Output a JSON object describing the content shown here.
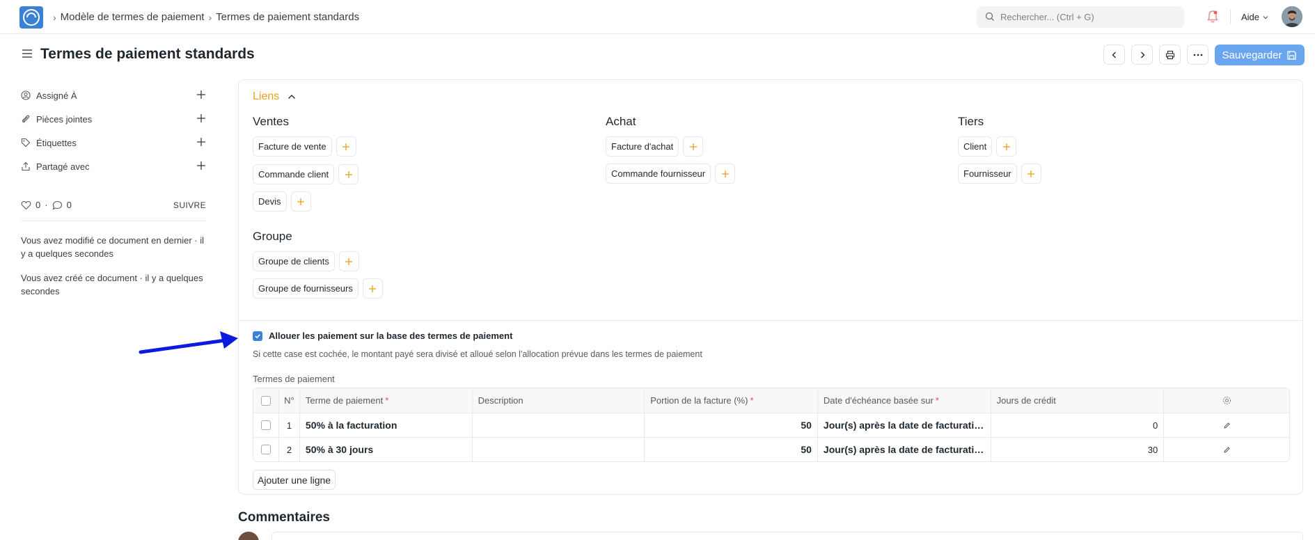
{
  "navbar": {
    "breadcrumbs": [
      "Modèle de termes de paiement",
      "Termes de paiement standards"
    ],
    "search_placeholder": "Rechercher... (Ctrl + G)",
    "help_label": "Aide"
  },
  "header": {
    "title": "Termes de paiement standards",
    "save_label": "Sauvegarder"
  },
  "sidebar": {
    "items": [
      {
        "label": "Assigné À",
        "icon": "assign-icon"
      },
      {
        "label": "Pièces jointes",
        "icon": "paperclip-icon"
      },
      {
        "label": "Étiquettes",
        "icon": "tag-icon"
      },
      {
        "label": "Partagé avec",
        "icon": "share-icon"
      }
    ],
    "likes_count": "0",
    "comments_count": "0",
    "follow_label": "SUIVRE",
    "activity": [
      "Vous avez modifié ce document en dernier · il y a quelques secondes",
      "Vous avez créé ce document · il y a quelques secondes"
    ]
  },
  "links": {
    "section_title": "Liens",
    "groups": {
      "ventes": {
        "title": "Ventes",
        "items": [
          "Facture de vente",
          "Commande client",
          "Devis"
        ]
      },
      "achat": {
        "title": "Achat",
        "items": [
          "Facture d'achat",
          "Commande fournisseur"
        ]
      },
      "tiers": {
        "title": "Tiers",
        "items": [
          "Client",
          "Fournisseur"
        ]
      },
      "groupe": {
        "title": "Groupe",
        "items": [
          "Groupe de clients",
          "Groupe de fournisseurs"
        ]
      }
    }
  },
  "allocation": {
    "checkbox_label": "Allouer les paiement sur la base des termes de paiement",
    "checked": true,
    "description": "Si cette case est cochée, le montant payé sera divisé et alloué selon l'allocation prévue dans les termes de paiement"
  },
  "table": {
    "label": "Termes de paiement",
    "columns": {
      "no": "N°",
      "term": "Terme de paiement",
      "description": "Description",
      "portion": "Portion de la facture (%)",
      "due": "Date d'échéance basée sur",
      "days": "Jours de crédit"
    },
    "rows": [
      {
        "no": "1",
        "term": "50% à la facturation",
        "description": "",
        "portion": "50",
        "due": "Jour(s) après la date de facturation",
        "days": "0"
      },
      {
        "no": "2",
        "term": "50% à 30 jours",
        "description": "",
        "portion": "50",
        "due": "Jour(s) après la date de facturation",
        "days": "30"
      }
    ],
    "add_row_label": "Ajouter une ligne"
  },
  "comments": {
    "title": "Commentaires"
  },
  "colors": {
    "accent": "#3b82d6",
    "section_title": "#e8a21a",
    "save_button": "#6aa6f0",
    "arrow": "#0a1adf"
  }
}
